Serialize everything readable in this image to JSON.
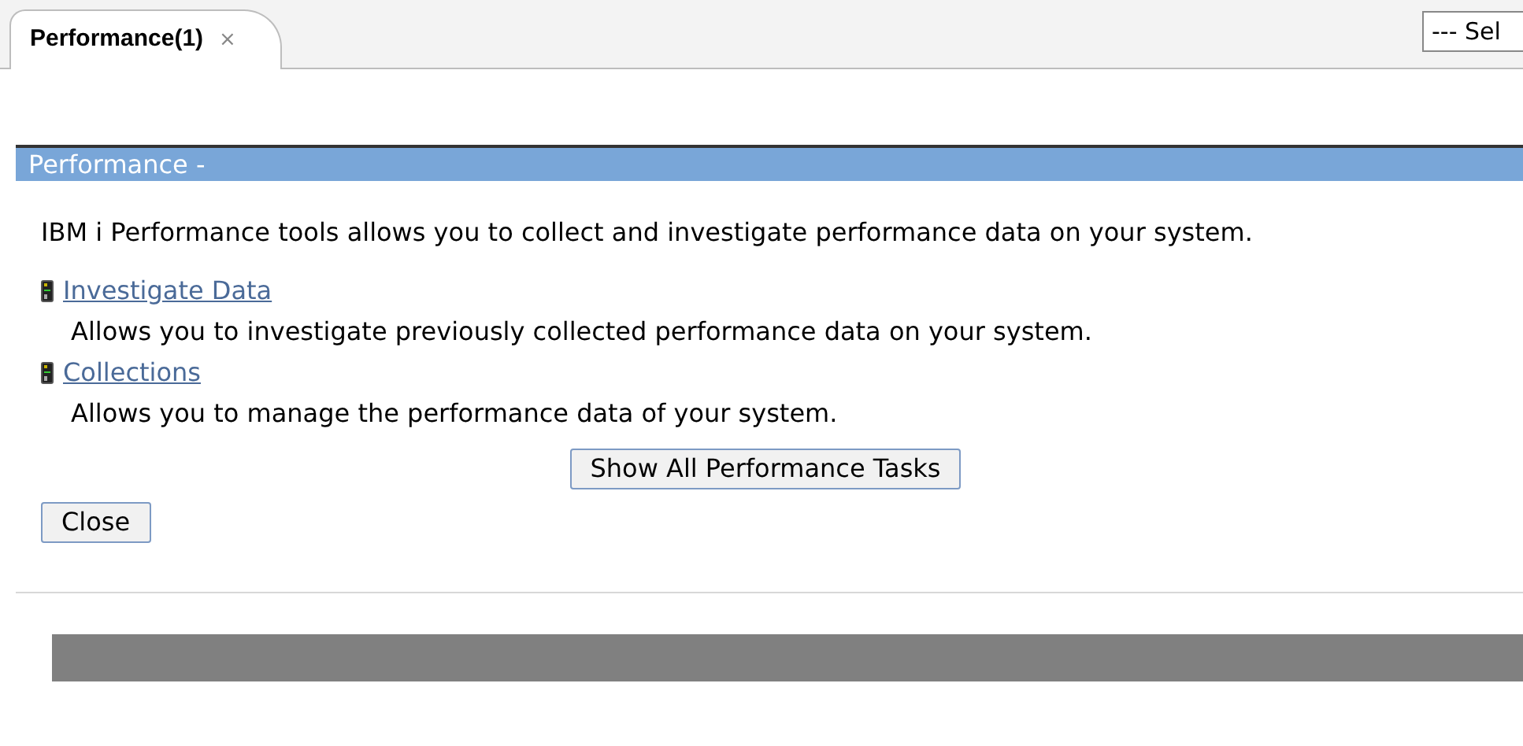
{
  "tabs": [
    {
      "label": "Performance(1)",
      "close": "×",
      "selected": true
    }
  ],
  "select": {
    "value": "--- Sel"
  },
  "panel": {
    "title": "Performance -",
    "intro": "IBM i Performance tools allows you to collect and investigate performance data on your system.",
    "tasks": [
      {
        "link": "Investigate Data",
        "description": "Allows you to investigate previously collected performance data on your system."
      },
      {
        "link": "Collections",
        "description": "Allows you to manage the performance data of your system."
      }
    ],
    "show_all_button": "Show All Performance Tasks",
    "close_button": "Close"
  }
}
